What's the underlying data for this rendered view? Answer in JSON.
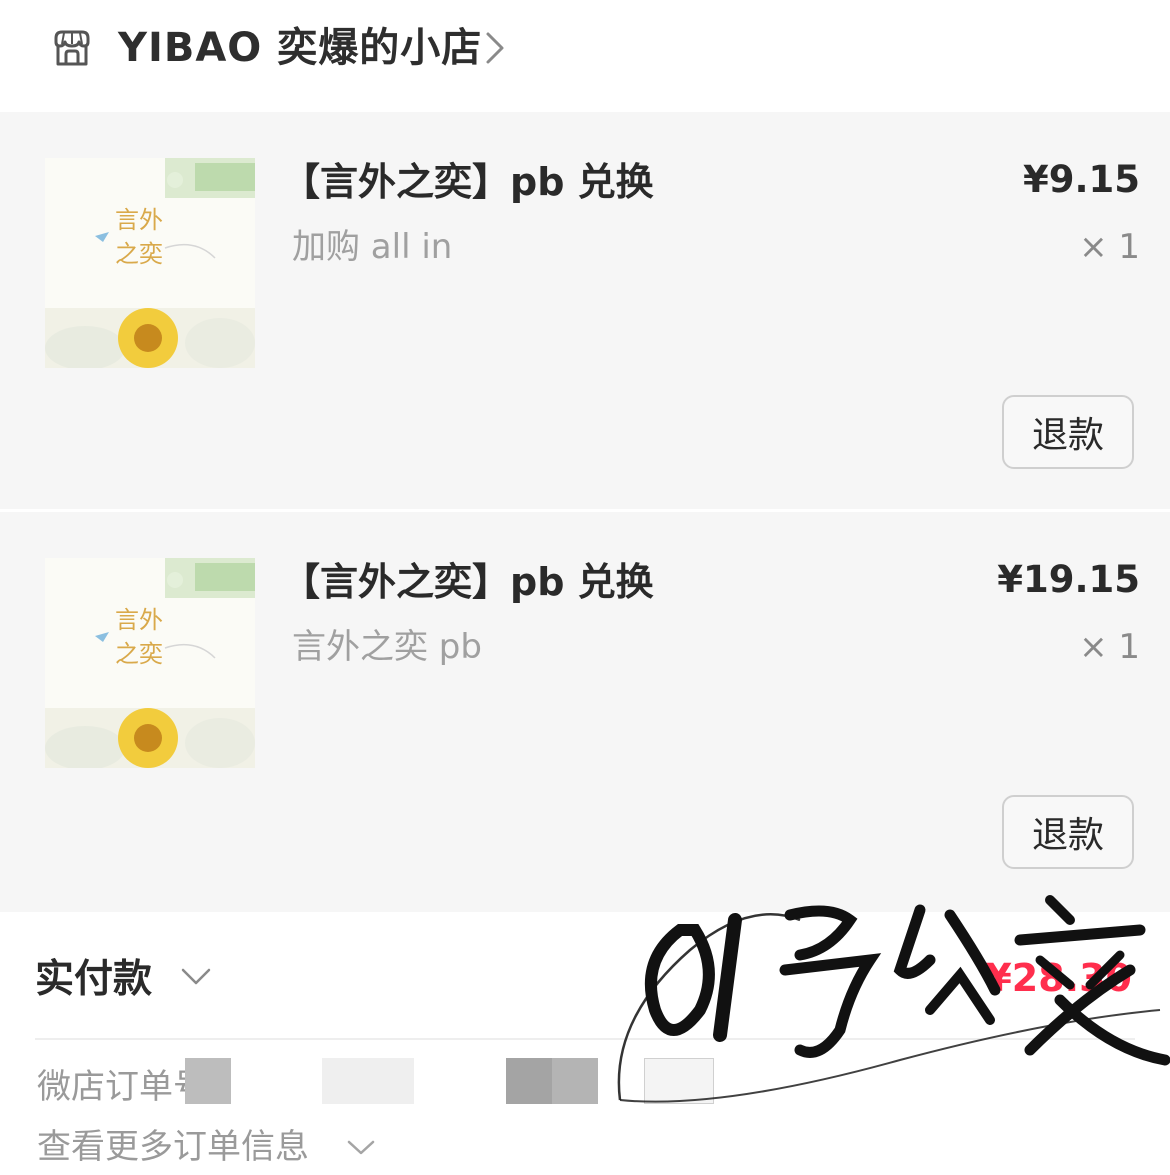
{
  "shop": {
    "name": "YIBAO 奕爆的小店"
  },
  "items": [
    {
      "title": "【言外之奕】pb 兑换",
      "spec": "加购 all in",
      "price": "¥9.15",
      "qty": "× 1",
      "refund_label": "退款"
    },
    {
      "title": "【言外之奕】pb 兑换",
      "spec": "言外之奕 pb",
      "price": "¥19.15",
      "qty": "× 1",
      "refund_label": "退款"
    }
  ],
  "payment": {
    "label": "实付款",
    "amount": "¥28.30",
    "amount_color": "#ff2e4d"
  },
  "order": {
    "order_no_label": "微店订单号",
    "more_info_label": "查看更多订单信息"
  },
  "watermark": {
    "text": "01号公交"
  }
}
